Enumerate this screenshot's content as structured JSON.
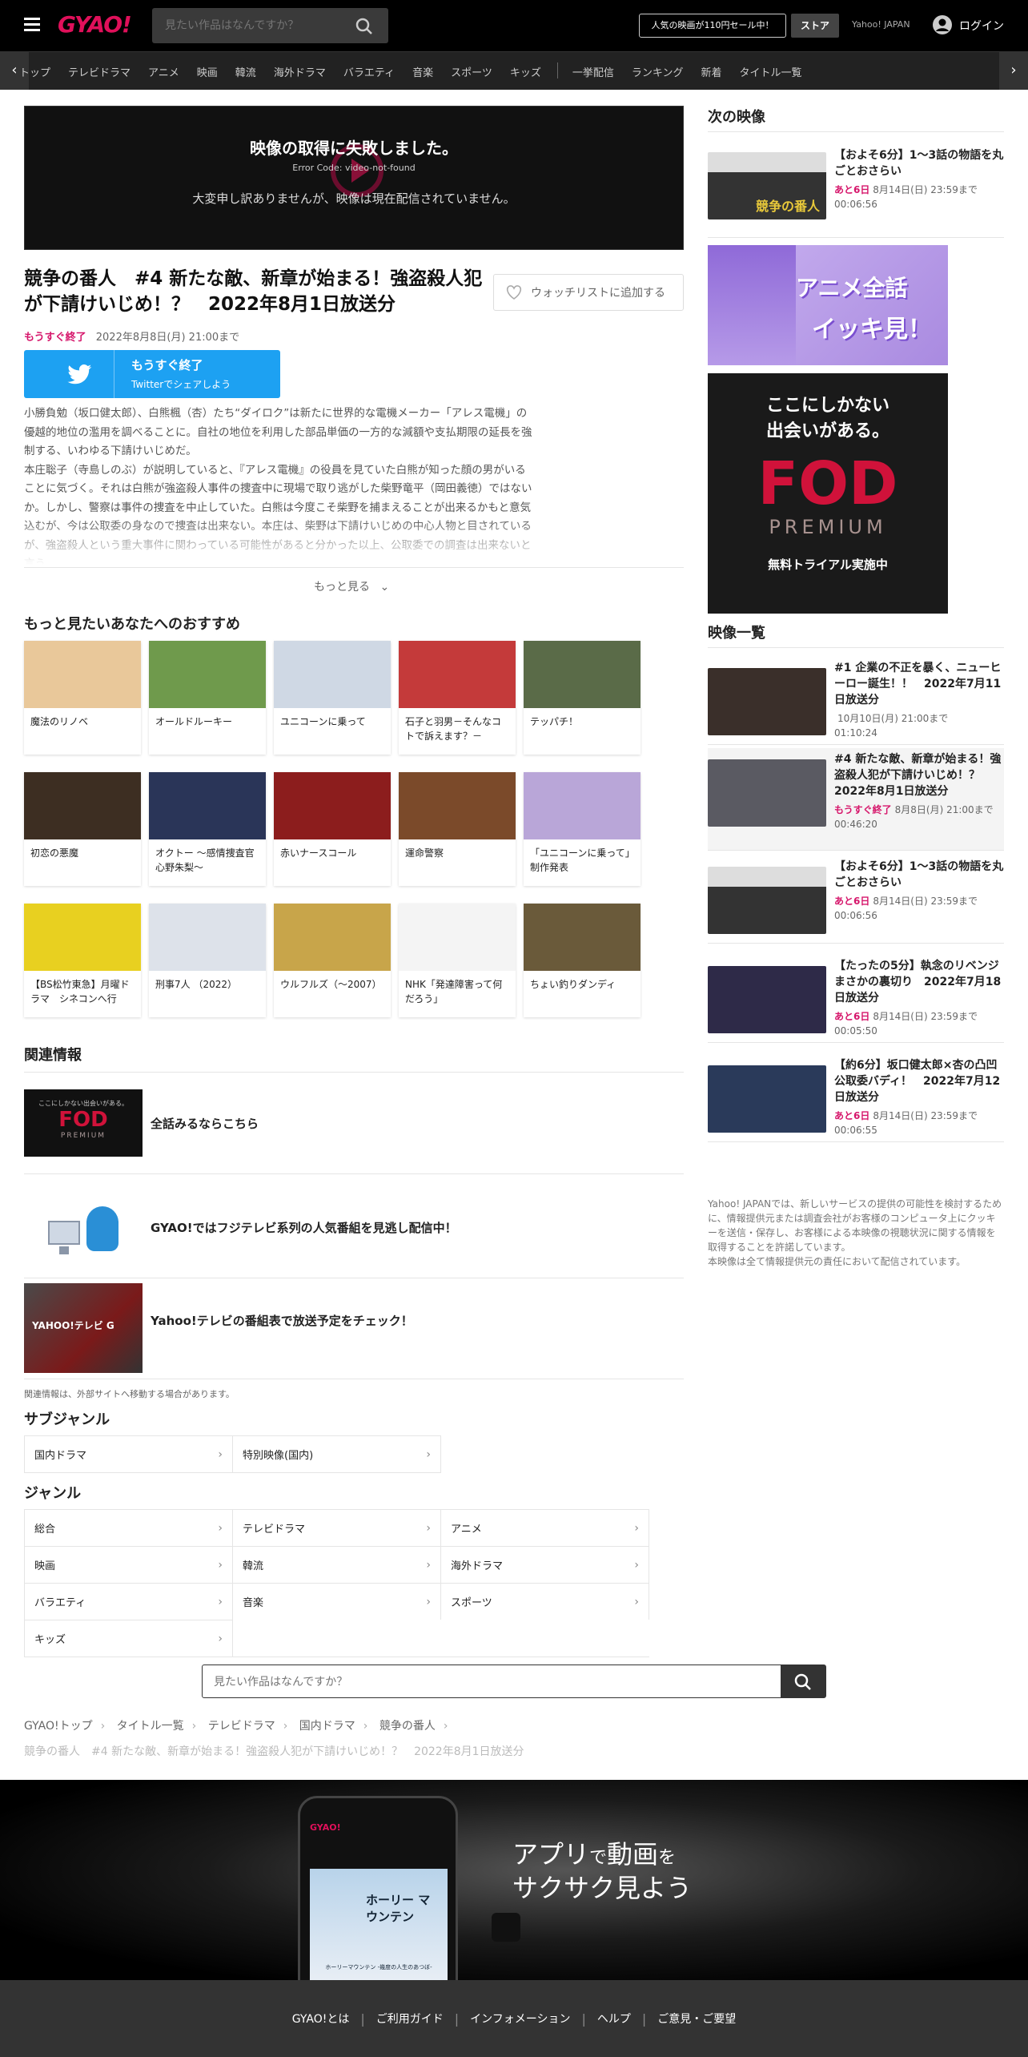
{
  "header": {
    "logo": "GYAO!",
    "search_placeholder": "見たい作品はなんですか？",
    "sale_label": "人気の映画が110円セール中！",
    "store_label": "ストア",
    "yahoo_label": "Yahoo! JAPAN",
    "login_label": "ログイン"
  },
  "nav": {
    "items": [
      "トップ",
      "テレビドラマ",
      "アニメ",
      "映画",
      "韓流",
      "海外ドラマ",
      "バラエティ",
      "音楽",
      "スポーツ",
      "キッズ",
      "一挙配信",
      "ランキング",
      "新着",
      "タイトル一覧"
    ]
  },
  "player": {
    "error_title": "映像の取得に失敗しました。",
    "error_code": "Error Code: video-not-found",
    "error_msg": "大変申し訳ありませんが、映像は現在配信されていません。"
  },
  "episode": {
    "title": "競争の番人　#4 新たな敵、新章が始まる！強盗殺人犯が下請けいじめ！？　2022年8月1日放送分",
    "ending_badge": "もうすぐ終了",
    "until": "2022年8月8日(月) 21:00まで",
    "watchlist_label": "ウォッチリストに追加する",
    "share_title": "もうすぐ終了",
    "share_sub": "Twitterでシェアしよう",
    "description": "小勝負勉（坂口健太郎）、白熊楓（杏）たち“ダイロク”は新たに世界的な電機メーカー「アレス電機」の優越的地位の濫用を調べることに。自社の地位を利用した部品単価の一方的な減額や支払期限の延長を強制する、いわゆる下請けいじめだ。\n本庄聡子（寺島しのぶ）が説明していると、『アレス電機』の役員を見ていた白熊が知った顔の男がいることに気づく。それは白熊が強盗殺人事件の捜査中に現場で取り逃がした柴野竜平（岡田義徳）ではないか。しかし、警察は事件の捜査を中止していた。白熊は今度こそ柴野を捕まえることが出来るかもと意気込むが、今は公取委の身なので捜査は出来ない。本庄は、柴野は下請けいじめの中心人物と目されているが、強盗殺人という重大事件に関わっている可能性があると分かった以上、公取委での調査は出来ないと言う。",
    "more_label": "もっと見る"
  },
  "recommend": {
    "heading": "もっと見たいあなたへのおすすめ",
    "items": [
      {
        "title": "魔法のリノベ",
        "color": "#e9c89a"
      },
      {
        "title": "オールドルーキー",
        "color": "#6f9a4c"
      },
      {
        "title": "ユニコーンに乗って",
        "color": "#cfd8e4"
      },
      {
        "title": "石子と羽男－そんなコトで訴えます？－",
        "color": "#c43a3a"
      },
      {
        "title": "テッパチ！",
        "color": "#5a6b48"
      },
      {
        "title": "初恋の悪魔",
        "color": "#3d2e22"
      },
      {
        "title": "オクトー ～感情捜査官 心野朱梨～",
        "color": "#2a3558"
      },
      {
        "title": "赤いナースコール",
        "color": "#8c1d1d"
      },
      {
        "title": "運命警察",
        "color": "#7b4a2a"
      },
      {
        "title": "「ユニコーンに乗って」制作発表",
        "color": "#b9a6d8"
      },
      {
        "title": "【BS松竹東急】月曜ドラマ　シネコンへ行",
        "color": "#e8d020"
      },
      {
        "title": "刑事7人 （2022）",
        "color": "#dde2ea"
      },
      {
        "title": "ウルフルズ（～2007）",
        "color": "#c8a54a"
      },
      {
        "title": "NHK「発達障害って何だろう」",
        "color": "#f4f4f4"
      },
      {
        "title": "ちょい釣りダンディ",
        "color": "#6a5a3a"
      }
    ]
  },
  "related": {
    "heading": "関連情報",
    "items": [
      {
        "title": "全話みるならこちら"
      },
      {
        "title": "GYAO!ではフジテレビ系列の人気番組を見逃し配信中！"
      },
      {
        "title": "Yahoo!テレビの番組表で放送予定をチェック！"
      }
    ],
    "note": "関連情報は、外部サイトへ移動する場合があります。"
  },
  "subgenre": {
    "heading": "サブジャンル",
    "items": [
      "国内ドラマ",
      "特別映像(国内)"
    ]
  },
  "genre": {
    "heading": "ジャンル",
    "items": [
      "総合",
      "テレビドラマ",
      "アニメ",
      "映画",
      "韓流",
      "海外ドラマ",
      "バラエティ",
      "音楽",
      "スポーツ",
      "キッズ"
    ]
  },
  "bottom_search": {
    "placeholder": "見たい作品はなんですか？"
  },
  "breadcrumb": {
    "items": [
      "GYAO!トップ",
      "タイトル一覧",
      "テレビドラマ",
      "国内ドラマ",
      "競争の番人"
    ],
    "current": "競争の番人　#4 新たな敵、新章が始まる！強盗殺人犯が下請けいじめ！？　2022年8月1日放送分"
  },
  "sidebar": {
    "next_heading": "次の映像",
    "next": {
      "title": "【およそ6分】1～3話の物語を丸ごとおさらい",
      "left": "あと6日",
      "date": "8月14日(日) 23:59まで",
      "duration": "00:06:56"
    },
    "ad1": {
      "line1": "アニメ全話",
      "line2": "イッキ見！"
    },
    "ad2": {
      "line1": "ここにしかない",
      "line2": "出会いがある。",
      "brand": "FOD",
      "sub": "PREMIUM",
      "cta": "無料トライアル実施中"
    },
    "list_heading": "映像一覧",
    "list": [
      {
        "title": "#1 企業の不正を暴く、ニューヒーロー誕生！！　2022年7月11日放送分",
        "left": "",
        "date": "10月10日(月) 21:00まで",
        "duration": "01:10:24"
      },
      {
        "title": "#4 新たな敵、新章が始まる！強盗殺人犯が下請けいじめ！？　2022年8月1日放送分",
        "left": "もうすぐ終了",
        "date": "8月8日(月) 21:00まで",
        "duration": "00:46:20"
      },
      {
        "title": "【およそ6分】1～3話の物語を丸ごとおさらい",
        "left": "あと6日",
        "date": "8月14日(日) 23:59まで",
        "duration": "00:06:56"
      },
      {
        "title": "【たったの5分】執念のリベンジまさかの裏切り　2022年7月18日放送分",
        "left": "あと6日",
        "date": "8月14日(日) 23:59まで",
        "duration": "00:05:50"
      },
      {
        "title": "【約6分】坂口健太郎×杏の凸凹公取委バディ！　2022年7月12日放送分",
        "left": "あと6日",
        "date": "8月14日(日) 23:59まで",
        "duration": "00:06:55"
      }
    ],
    "notice": "Yahoo! JAPANでは、新しいサービスの提供の可能性を検討するために、情報提供元または調査会社がお客様のコンピュータ上にクッキーを送信・保存し、お客様による本映像の視聴状況に関する情報を取得することを許諾しています。\n本映像は全て情報提供元の責任において配信されています。"
  },
  "app_promo": {
    "line1a": "アプリ",
    "line1b": "で",
    "line1c": "動画",
    "line1d": "を",
    "line2": "サクサク見よう",
    "phone_title": "ホーリー マウンテン",
    "phone_caption": "ホーリーマウンテン -幾度の人生のあつぼ-"
  },
  "footer": {
    "links": [
      "GYAO!とは",
      "ご利用ガイド",
      "インフォメーション",
      "ヘルプ",
      "ご意見・ご要望"
    ]
  }
}
